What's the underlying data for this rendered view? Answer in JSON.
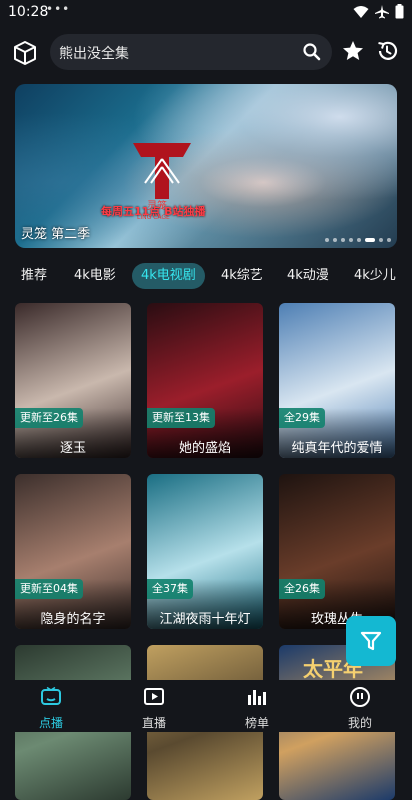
{
  "status_bar": {
    "time": "10:28",
    "dots": "•••"
  },
  "search": {
    "query": "熊出没全集"
  },
  "banner": {
    "logo_text": "灵笼",
    "logo_sub": "LING CAGE",
    "slogan": "每周五11点 B站独播",
    "caption": "灵笼 第二季",
    "slides": 8,
    "active_slide": 5
  },
  "tabs": [
    {
      "label": "推荐"
    },
    {
      "label": "4k电影"
    },
    {
      "label": "4k电视剧",
      "active": true
    },
    {
      "label": "4k综艺"
    },
    {
      "label": "4k动漫"
    },
    {
      "label": "4k少儿"
    }
  ],
  "cards": [
    {
      "title": "逐玉",
      "badge": "更新至26集",
      "colors": [
        "#3a2a2a",
        "#c9b8ad"
      ]
    },
    {
      "title": "她的盛焰",
      "badge": "更新至13集",
      "colors": [
        "#2a0d12",
        "#9b1e2b"
      ]
    },
    {
      "title": "纯真年代的爱情",
      "badge": "全29集",
      "colors": [
        "#4e7fb4",
        "#d9e6f1"
      ]
    },
    {
      "title": "隐身的名字",
      "badge": "更新至04集",
      "colors": [
        "#3c2f2c",
        "#a77f6e"
      ]
    },
    {
      "title": "江湖夜雨十年灯",
      "badge": "全37集",
      "colors": [
        "#1a6e83",
        "#b6e0ea"
      ]
    },
    {
      "title": "玫瑰丛生",
      "badge": "全26集",
      "colors": [
        "#1e1310",
        "#6a3d2a"
      ]
    },
    {
      "title": "",
      "badge": "",
      "colors": [
        "#2c3a30",
        "#6c8a72"
      ]
    },
    {
      "title": "",
      "badge": "",
      "colors": [
        "#c0a060",
        "#5a4a30"
      ]
    },
    {
      "title": "",
      "badge": "",
      "colors": [
        "#1b3a6a",
        "#d0a060"
      ],
      "art_text": "太平年"
    }
  ],
  "bottom_nav": [
    {
      "label": "点播",
      "active": true
    },
    {
      "label": "直播"
    },
    {
      "label": "榜单"
    },
    {
      "label": "我的"
    }
  ],
  "accent": "#2dc9e0"
}
